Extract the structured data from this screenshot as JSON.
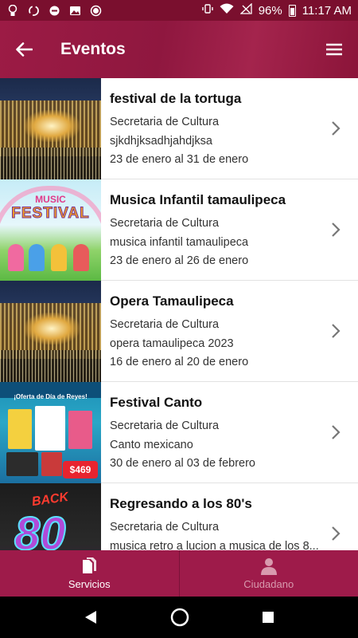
{
  "status_bar": {
    "battery": "96%",
    "time": "11:17 AM"
  },
  "app_bar": {
    "title": "Eventos"
  },
  "events": [
    {
      "name": "festival de la tortuga",
      "organizer": "Secretaria de Cultura",
      "description": "sjkdhjksadhjahdjksa",
      "dates": "23 de enero al 31 de enero",
      "image": "opera"
    },
    {
      "name": "Musica Infantil tamaulipeca",
      "organizer": "Secretaria de Cultura",
      "description": "musica infantil tamaulipeca",
      "dates": "23 de enero al 26 de enero",
      "image": "music-festival"
    },
    {
      "name": "Opera Tamaulipeca",
      "organizer": "Secretaria de Cultura",
      "description": "opera tamaulipeca 2023",
      "dates": "16 de enero al 20 de enero",
      "image": "opera"
    },
    {
      "name": "Festival Canto",
      "organizer": "Secretaria de Cultura",
      "description": "Canto mexicano",
      "dates": "30 de enero al 03 de febrero",
      "image": "promo"
    },
    {
      "name": "Regresando a los 80's",
      "organizer": "Secretaria de Cultura",
      "description": "musica retro a lucion a musica de los 8...",
      "dates": "",
      "image": "back-to-80s"
    }
  ],
  "thumb_text": {
    "music": "MUSIC",
    "festival": "FESTIVAL",
    "oferta": "¡Oferta de Día de Reyes!",
    "price": "$469",
    "back": "BACK",
    "eighty": "80"
  },
  "bottom_nav": {
    "servicios": "Servicios",
    "ciudadano": "Ciudadano"
  },
  "colors": {
    "primary": "#9e1b4a",
    "status_bar": "#7a0f2e"
  }
}
